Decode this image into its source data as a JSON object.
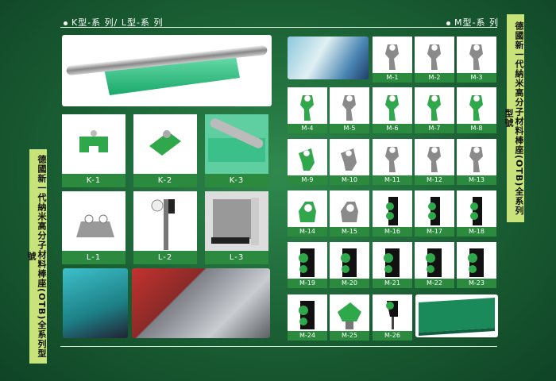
{
  "header_left": "K型-系 列/ L型-系 列",
  "header_right": "M型-系 列",
  "side_text": "德國新一代納米高分子材料棒座(OTB)全系列型號",
  "k_items": [
    "K-1",
    "K-2",
    "K-3"
  ],
  "l_items": [
    "L-1",
    "L-2",
    "L-3"
  ],
  "m_items": [
    "M-1",
    "M-2",
    "M-3",
    "M-4",
    "M-5",
    "M-6",
    "M-7",
    "M-8",
    "M-9",
    "M-10",
    "M-11",
    "M-12",
    "M-13",
    "M-14",
    "M-15",
    "M-16",
    "M-17",
    "M-18",
    "M-19",
    "M-20",
    "M-21",
    "M-22",
    "M-23",
    "M-24",
    "M-25",
    "M-26"
  ],
  "colors": {
    "brand_green": "#2b8a3e",
    "side_bar": "#c8e37a",
    "part_green": "#2ea84a",
    "part_gray": "#8a8a8a",
    "part_black": "#111111"
  }
}
